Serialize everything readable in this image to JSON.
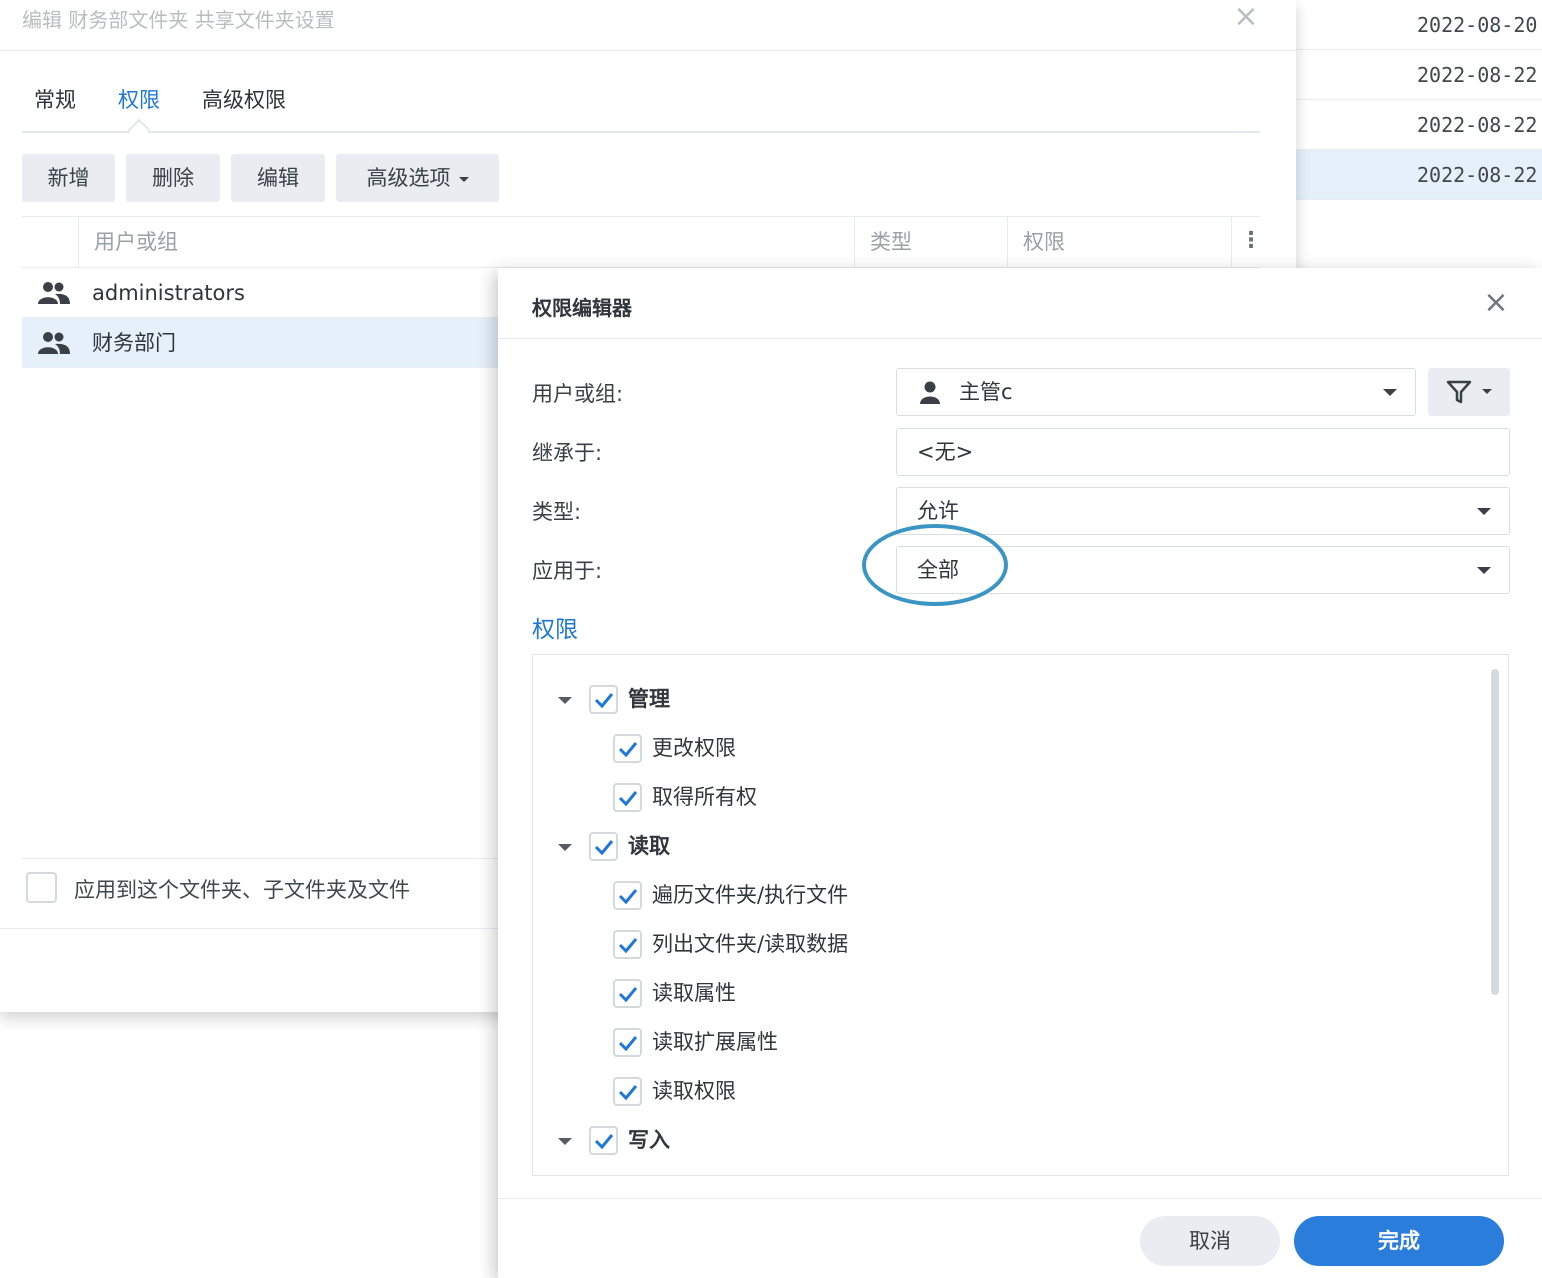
{
  "background_list": {
    "rows": [
      {
        "date": "2022-08-20"
      },
      {
        "date": "2022-08-22"
      },
      {
        "date": "2022-08-22"
      },
      {
        "date": "2022-08-22"
      }
    ]
  },
  "main_dialog": {
    "title": "编辑 财务部文件夹 共享文件夹设置",
    "close_glyph": "×",
    "tabs": [
      {
        "label": "常规",
        "active": false
      },
      {
        "label": "权限",
        "active": true
      },
      {
        "label": "高级权限",
        "active": false
      }
    ],
    "toolbar": {
      "add_label": "新增",
      "delete_label": "删除",
      "edit_label": "编辑",
      "advanced_label": "高级选项"
    },
    "grid": {
      "columns": [
        "用户或组",
        "类型",
        "权限"
      ],
      "menu_glyph": "⋮",
      "rows": [
        {
          "name": "administrators",
          "icon": "user-group-icon",
          "selected": false
        },
        {
          "name": "财务部门",
          "icon": "user-group-icon",
          "selected": true
        }
      ]
    },
    "apply_option_label": "应用到这个文件夹、子文件夹及文件"
  },
  "permission_editor": {
    "title": "权限编辑器",
    "close_glyph": "×",
    "fields": {
      "user_label": "用户或组:",
      "user_value": "主管c",
      "inherit_label": "继承于:",
      "inherit_value": "<无>",
      "type_label": "类型:",
      "type_value": "允许",
      "apply_label": "应用于:",
      "apply_value": "全部"
    },
    "section_title": "权限",
    "tree": [
      {
        "label": "管理",
        "level": 0,
        "checked": true,
        "expanded": true
      },
      {
        "label": "更改权限",
        "level": 1,
        "checked": true
      },
      {
        "label": "取得所有权",
        "level": 1,
        "checked": true
      },
      {
        "label": "读取",
        "level": 0,
        "checked": true,
        "expanded": true
      },
      {
        "label": "遍历文件夹/执行文件",
        "level": 1,
        "checked": true
      },
      {
        "label": "列出文件夹/读取数据",
        "level": 1,
        "checked": true
      },
      {
        "label": "读取属性",
        "level": 1,
        "checked": true
      },
      {
        "label": "读取扩展属性",
        "level": 1,
        "checked": true
      },
      {
        "label": "读取权限",
        "level": 1,
        "checked": true
      },
      {
        "label": "写入",
        "level": 0,
        "checked": true,
        "expanded": true
      }
    ],
    "cancel_label": "取消",
    "done_label": "完成"
  },
  "colors": {
    "accent": "#2a7ddb",
    "active_tab": "#1f77d6",
    "selected_row": "#e6f0fa",
    "highlight_ring": "#3b95c4"
  }
}
